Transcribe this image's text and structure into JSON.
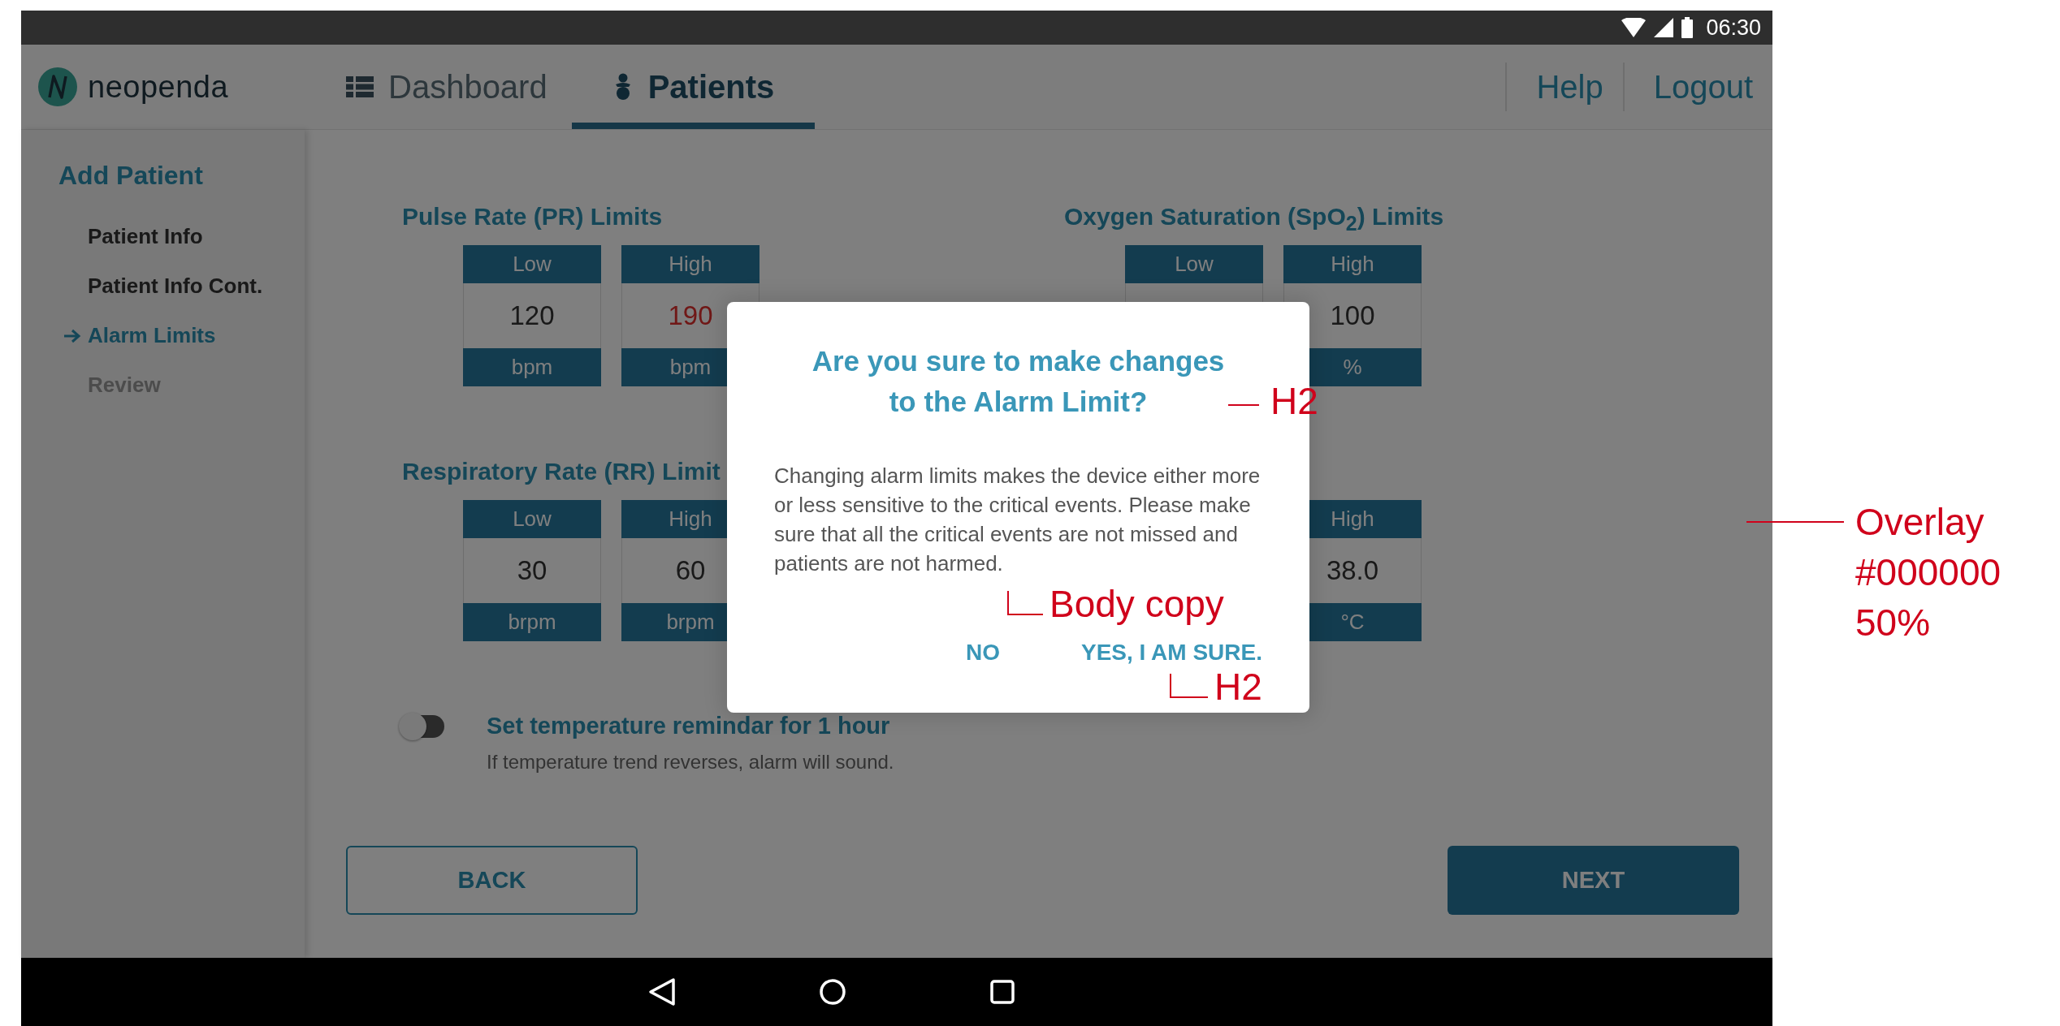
{
  "status_bar": {
    "time": "06:30"
  },
  "header": {
    "logo": "neopenda",
    "tabs": [
      {
        "label": "Dashboard",
        "selected": false
      },
      {
        "label": "Patients",
        "selected": true
      }
    ],
    "links": [
      "Help",
      "Logout"
    ]
  },
  "sidebar": {
    "title": "Add Patient",
    "items": [
      {
        "label": "Patient Info",
        "completed": true,
        "selected": false
      },
      {
        "label": "Patient Info Cont.",
        "completed": true,
        "selected": false
      },
      {
        "label": "Alarm Limits",
        "selected": true
      },
      {
        "label": "Review",
        "completed": false,
        "selected": false
      }
    ]
  },
  "limit_groups": [
    {
      "title": "Pulse Rate (PR) Limits",
      "fields": [
        {
          "header": "Low",
          "value": "120",
          "unit": "bpm"
        },
        {
          "header": "High",
          "value": "190",
          "unit": "bpm",
          "alert": true
        }
      ]
    },
    {
      "title": "Oxygen Saturation (SpO$_{2}$) Limits",
      "fields": [
        {
          "header": "Low"
        },
        {
          "header": "High",
          "value": "100",
          "unit": "%"
        }
      ]
    },
    {
      "title": "Respiratory Rate (RR) Limit",
      "fields": [
        {
          "header": "Low",
          "value": "30",
          "unit": "brpm"
        },
        {
          "header": "High",
          "value": "60",
          "unit": "brpm"
        }
      ]
    },
    {
      "fields": [
        {
          "header": "High",
          "value": "38.0",
          "unit": "°C"
        }
      ]
    }
  ],
  "toggle": {
    "label": "Set temperature remindar for 1 hour",
    "description": "If temperature trend reverses, alarm will sound.",
    "on": false
  },
  "footer_buttons": [
    {
      "label": "BACK",
      "kind": "outline"
    },
    {
      "label": "NEXT",
      "kind": "filled"
    }
  ],
  "dialog": {
    "title": "Are you sure to make changes to the Alarm Limit?",
    "body": "Changing alarm limits makes the device either more or less sensitive to the critical events. Please make sure that all the critical events are not missed and patients are not harmed.",
    "buttons": [
      "NO",
      "YES, I AM SURE."
    ]
  },
  "annotations": [
    {
      "kind": "side",
      "text": "H2"
    },
    {
      "kind": "corner",
      "text": "Body copy"
    },
    {
      "kind": "corner",
      "text": "H2"
    },
    {
      "kind": "side",
      "lines": [
        "Overlay",
        "#000000",
        "50%"
      ]
    }
  ]
}
